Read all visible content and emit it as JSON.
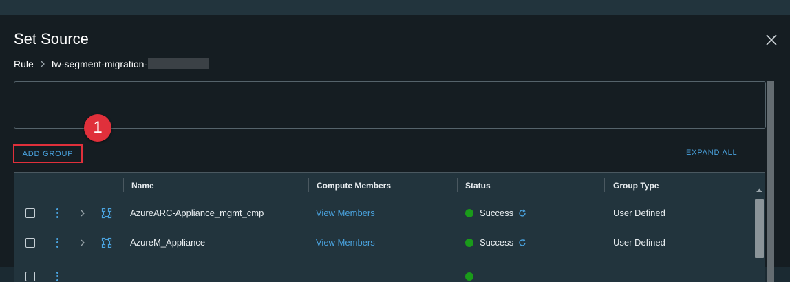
{
  "dialog": {
    "title": "Set Source",
    "breadcrumb": {
      "root": "Rule",
      "current": "fw-segment-migration-"
    }
  },
  "callout": {
    "number": "1"
  },
  "actions": {
    "add_group": "ADD GROUP",
    "expand_all": "EXPAND ALL"
  },
  "table": {
    "columns": [
      "Name",
      "Compute Members",
      "Status",
      "Group Type"
    ],
    "rows": [
      {
        "name": "AzureARC-Appliance_mgmt_cmp",
        "compute_members": "View Members",
        "status": "Success",
        "group_type": "User Defined"
      },
      {
        "name": "AzureM_Appliance",
        "compute_members": "View Members",
        "status": "Success",
        "group_type": "User Defined"
      }
    ]
  },
  "colors": {
    "accent": "#4aa3df",
    "highlight": "#e0303b",
    "success": "#1a9b1a"
  }
}
